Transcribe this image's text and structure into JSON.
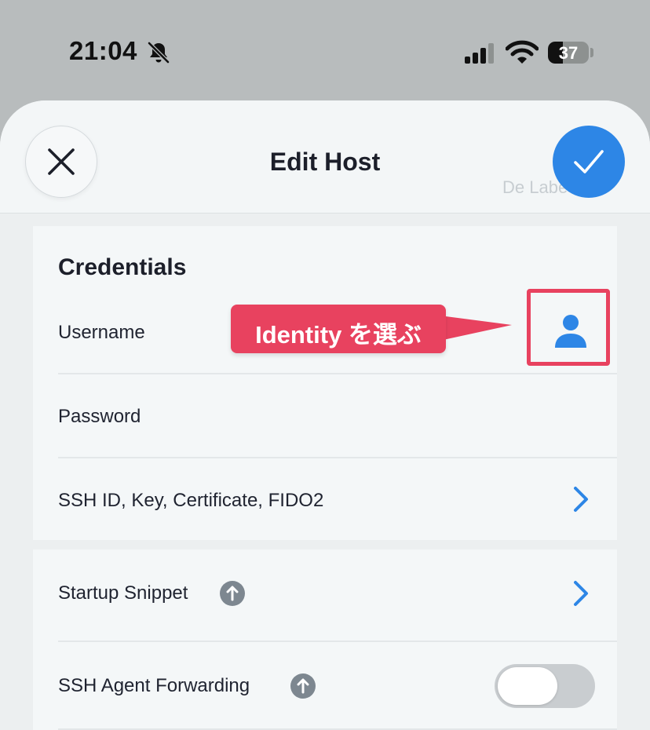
{
  "status_bar": {
    "time": "21:04",
    "battery_level": "37",
    "battery_fraction": 0.37,
    "icons": [
      "bell-slash-icon",
      "cellular-signal-icon",
      "wifi-icon",
      "battery-icon"
    ]
  },
  "header": {
    "title": "Edit Host",
    "ghost_text": "De Labe",
    "close_icon": "close-icon",
    "confirm_icon": "checkmark-icon"
  },
  "credentials": {
    "section_title": "Credentials",
    "username_label": "Username",
    "password_label": "Password",
    "ssh_label": "SSH ID, Key, Certificate, FIDO2",
    "identity_icon": "person-icon"
  },
  "annotation": {
    "callout_text": "Identity を選ぶ",
    "color": "#e8425f"
  },
  "advanced": {
    "startup_snippet_label": "Startup Snippet",
    "agent_forwarding_label": "SSH Agent Forwarding",
    "agent_forwarding_enabled": false,
    "upgrade_icon": "arrow-up-circle-icon"
  },
  "colors": {
    "accent": "#2d86e6",
    "annotation": "#e8425f",
    "background": "#b8bcbd",
    "sheet": "#eceff0",
    "card": "#f4f7f8"
  }
}
